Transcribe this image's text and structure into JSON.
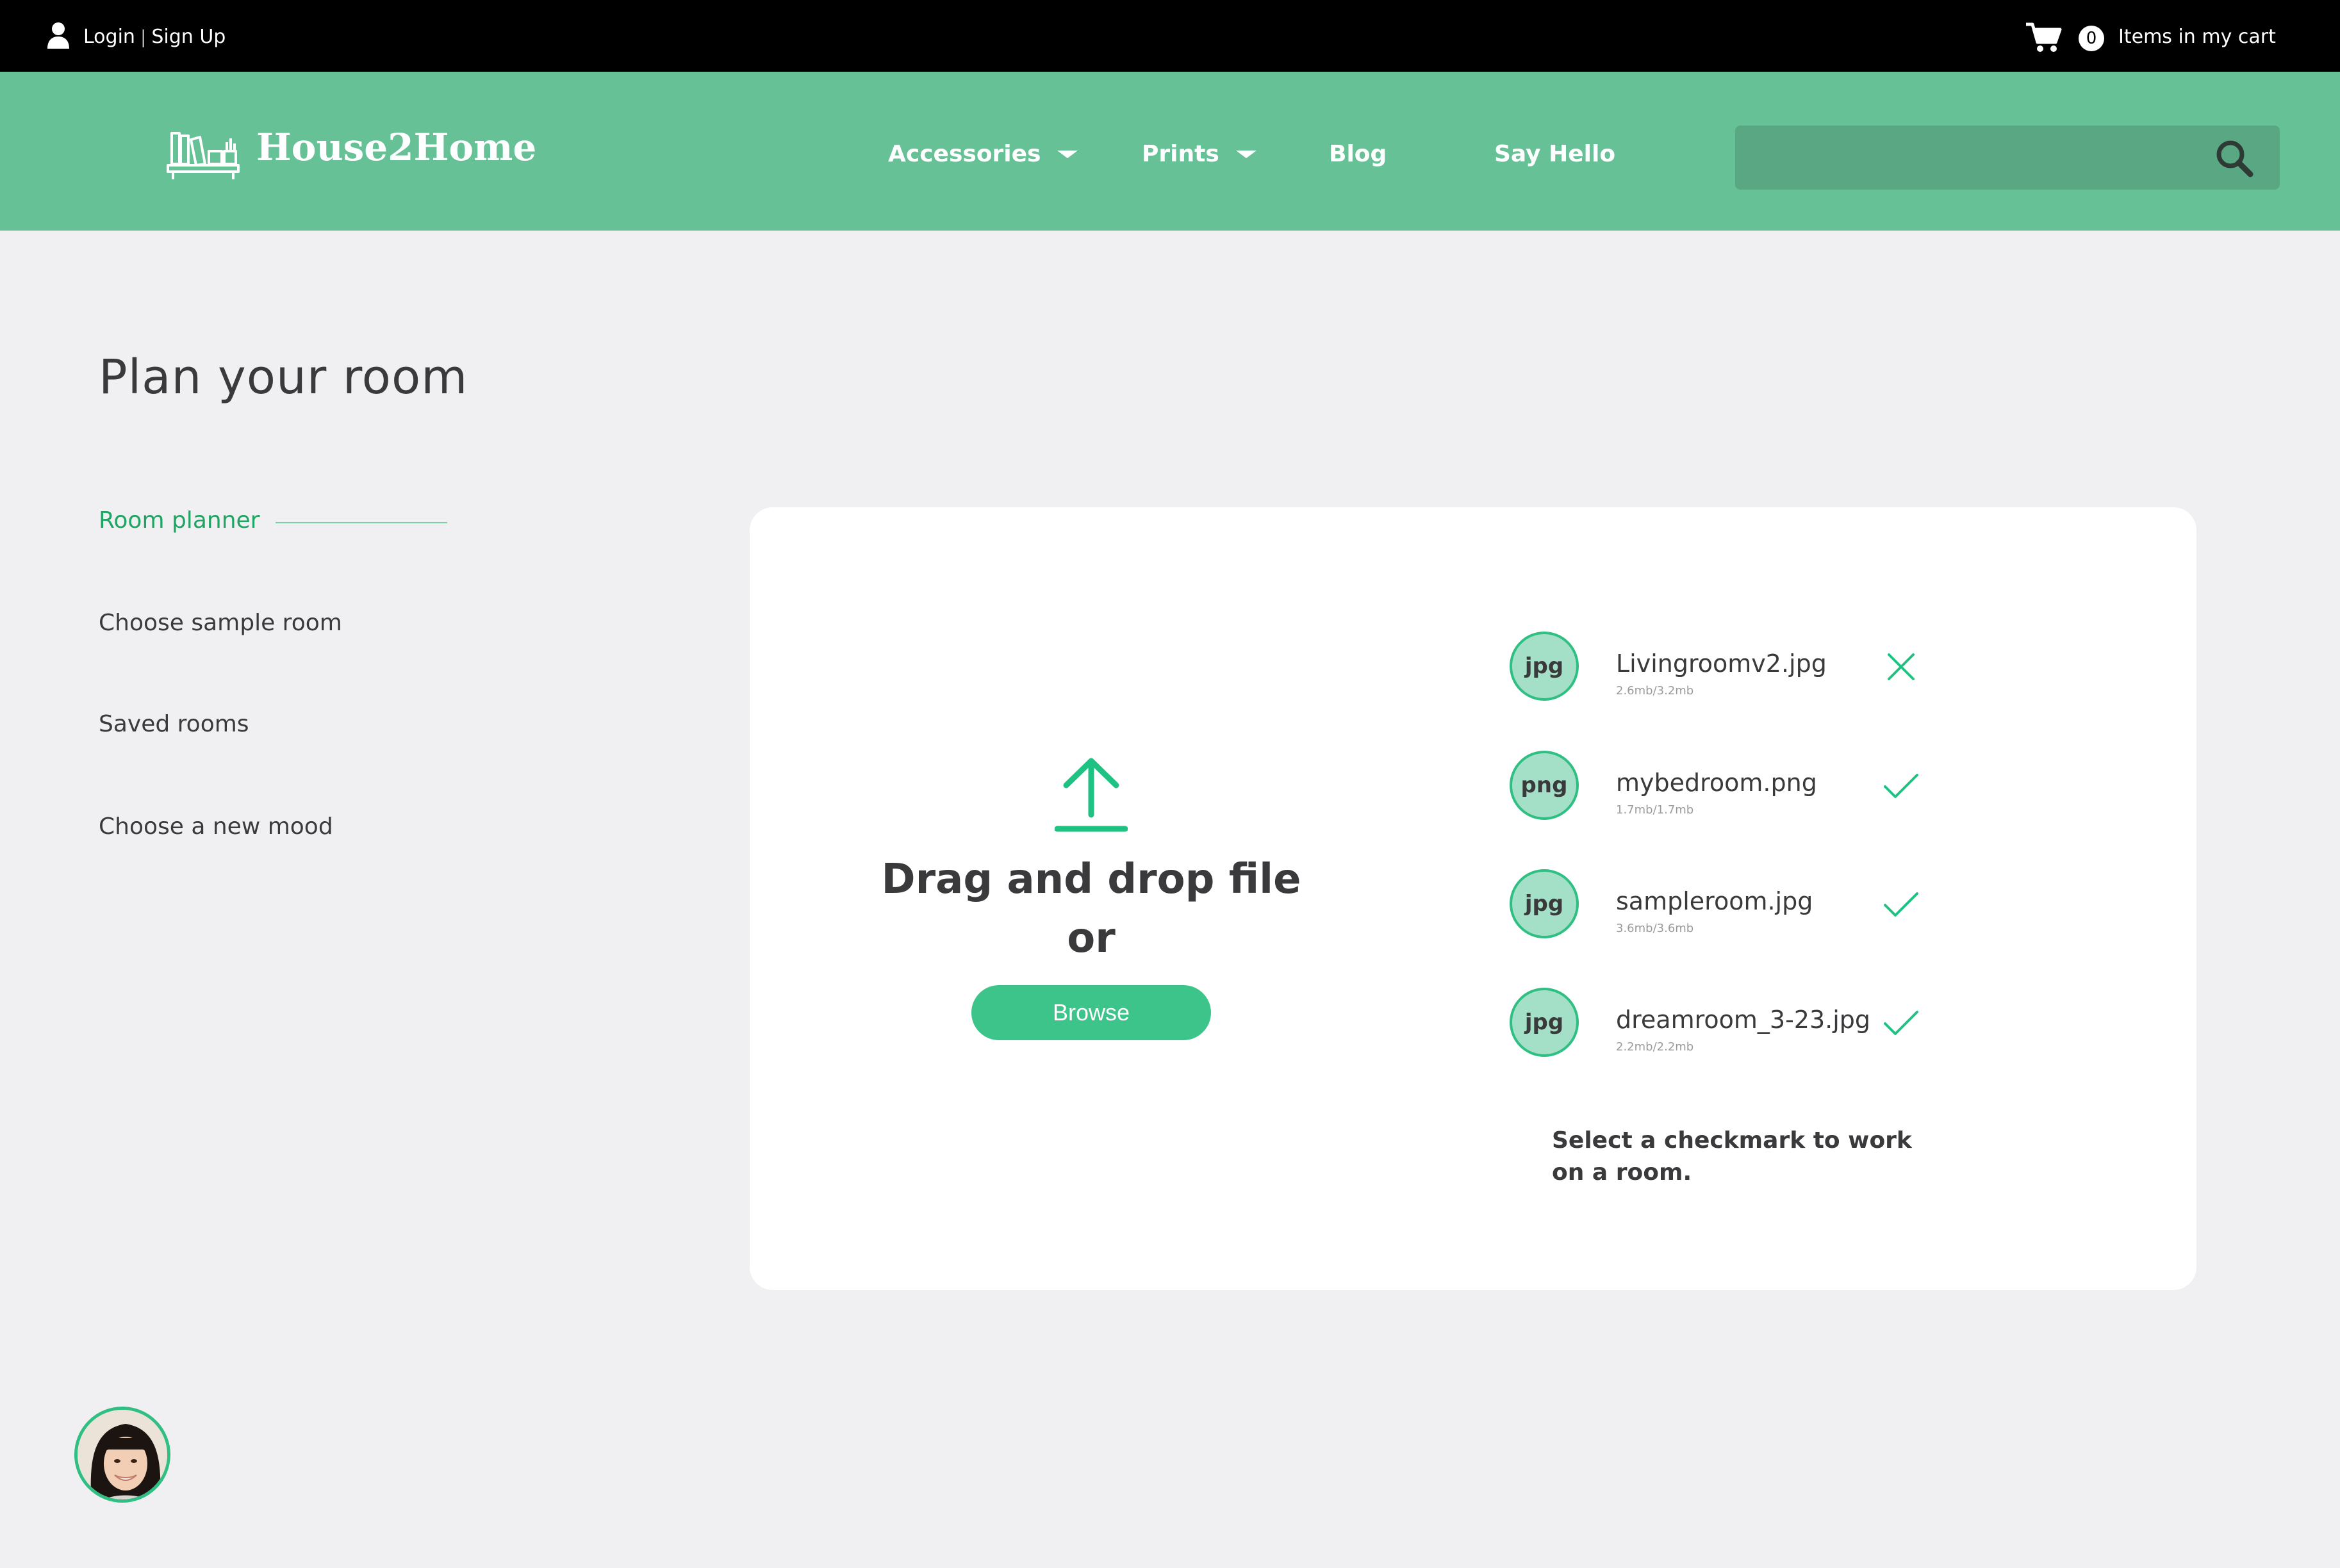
{
  "topbar": {
    "login_label": "Login",
    "separator": "|",
    "signup_label": "Sign Up",
    "cart_count": "0",
    "cart_label": "Items in my cart",
    "user_icon": "user-icon",
    "cart_icon": "cart-icon"
  },
  "header": {
    "brand": "House2Home",
    "logo_icon": "bookshelf-logo-icon",
    "nav": [
      {
        "label": "Accessories",
        "has_dropdown": true
      },
      {
        "label": "Prints",
        "has_dropdown": true
      },
      {
        "label": "Blog",
        "has_dropdown": false
      },
      {
        "label": "Say Hello",
        "has_dropdown": false
      }
    ],
    "search": {
      "placeholder": "",
      "value": "",
      "icon": "search-icon"
    }
  },
  "page": {
    "title": "Plan your room"
  },
  "sidebar": {
    "items": [
      {
        "label": "Room planner",
        "active": true
      },
      {
        "label": "Choose sample room",
        "active": false
      },
      {
        "label": "Saved rooms",
        "active": false
      },
      {
        "label": "Choose a new mood",
        "active": false
      }
    ]
  },
  "upload": {
    "icon": "upload-icon",
    "drag_text": "Drag and drop file",
    "or_text": "or",
    "browse_label": "Browse"
  },
  "files": [
    {
      "type": "jpg",
      "name": "Livingroomv2.jpg",
      "size": "2.6mb/3.2mb",
      "status": "cancel",
      "icon": "close-icon"
    },
    {
      "type": "png",
      "name": "mybedroom.png",
      "size": "1.7mb/1.7mb",
      "status": "complete",
      "icon": "checkmark-icon"
    },
    {
      "type": "jpg",
      "name": "sampleroom.jpg",
      "size": "3.6mb/3.6mb",
      "status": "complete",
      "icon": "checkmark-icon"
    },
    {
      "type": "jpg",
      "name": "dreamroom_3-23.jpg",
      "size": "2.2mb/2.2mb",
      "status": "complete",
      "icon": "checkmark-icon"
    }
  ],
  "hint": "Select a checkmark to work on a room.",
  "colors": {
    "accent": "#3cc48a",
    "header_bg": "#66c296",
    "active_text": "#1fa463",
    "topbar_bg": "#000000",
    "page_bg": "#f0f0f2"
  },
  "chat_avatar": "support-avatar"
}
